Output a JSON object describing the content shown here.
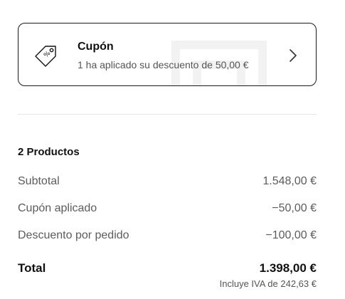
{
  "coupon": {
    "title": "Cupón",
    "subtitle": "1 ha aplicado su descuento de 50,00 €",
    "icon": "tag-icon",
    "action_icon": "chevron-right-icon"
  },
  "summary": {
    "products_heading": "2 Productos",
    "rows": [
      {
        "label": "Subtotal",
        "value": "1.548,00 €"
      },
      {
        "label": "Cupón aplicado",
        "value": "−50,00 €"
      },
      {
        "label": "Descuento por pedido",
        "value": "−100,00 €"
      }
    ],
    "total_label": "Total",
    "total_value": "1.398,00 €",
    "tax_note": "Incluye IVA de 242,63 €"
  },
  "colors": {
    "text": "#111111",
    "muted": "#5c5c5c",
    "border": "#1a1a1a",
    "divider": "#e4e4e4"
  }
}
